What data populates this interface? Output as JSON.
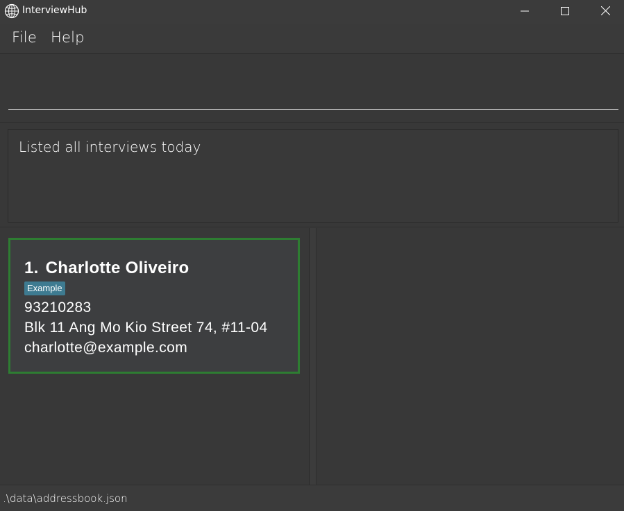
{
  "window": {
    "title": "InterviewHub",
    "app_icon": "globe-icon",
    "controls": [
      "minimize-icon",
      "maximize-icon",
      "close-icon"
    ]
  },
  "menu": {
    "file_label": "File",
    "help_label": "Help"
  },
  "command": {
    "value": "",
    "placeholder": ""
  },
  "result": {
    "message": "Listed all interviews today"
  },
  "interviews": [
    {
      "index": "1.",
      "name": "Charlotte Oliveiro",
      "tag": "Example",
      "phone": "93210283",
      "address": "Blk 11 Ang Mo Kio Street 74, #11-04",
      "email": "charlotte@example.com"
    }
  ],
  "status": {
    "file_path": ".\\data\\addressbook.json"
  },
  "colors": {
    "card_border": "#2e7d32",
    "tag_background": "#3e7b91",
    "background": "#383838"
  }
}
